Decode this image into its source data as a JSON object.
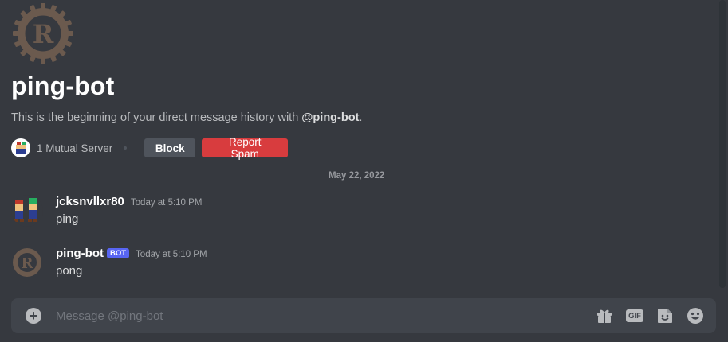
{
  "channel": {
    "title": "ping-bot",
    "intro_prefix": "This is the beginning of your direct message history with ",
    "intro_mention": "@ping-bot",
    "intro_suffix": ".",
    "avatar_icon": "rust-gear-logo-icon"
  },
  "profile_actions": {
    "mutual_servers": "1 Mutual Server",
    "block_label": "Block",
    "report_spam_label": "Report Spam"
  },
  "divider": {
    "date": "May 22, 2022"
  },
  "messages": [
    {
      "username": "jcksnvllxr80",
      "bot": false,
      "timestamp": "Today at 5:10 PM",
      "text": "ping",
      "avatar_icon": "mario-luigi-avatar-icon"
    },
    {
      "username": "ping-bot",
      "bot": true,
      "bot_label": "BOT",
      "timestamp": "Today at 5:10 PM",
      "text": "pong",
      "avatar_icon": "rust-gear-logo-icon"
    }
  ],
  "composer": {
    "placeholder": "Message @ping-bot",
    "add_icon": "plus-circle-icon",
    "gift_icon": "gift-icon",
    "gif_label": "GIF",
    "sticker_icon": "sticker-icon",
    "emoji_icon": "emoji-icon"
  },
  "colors": {
    "background": "#36393f",
    "composer": "#40444b",
    "block_button": "#4f545c",
    "report_button": "#d83c3e",
    "bot_tag": "#5865f2"
  }
}
